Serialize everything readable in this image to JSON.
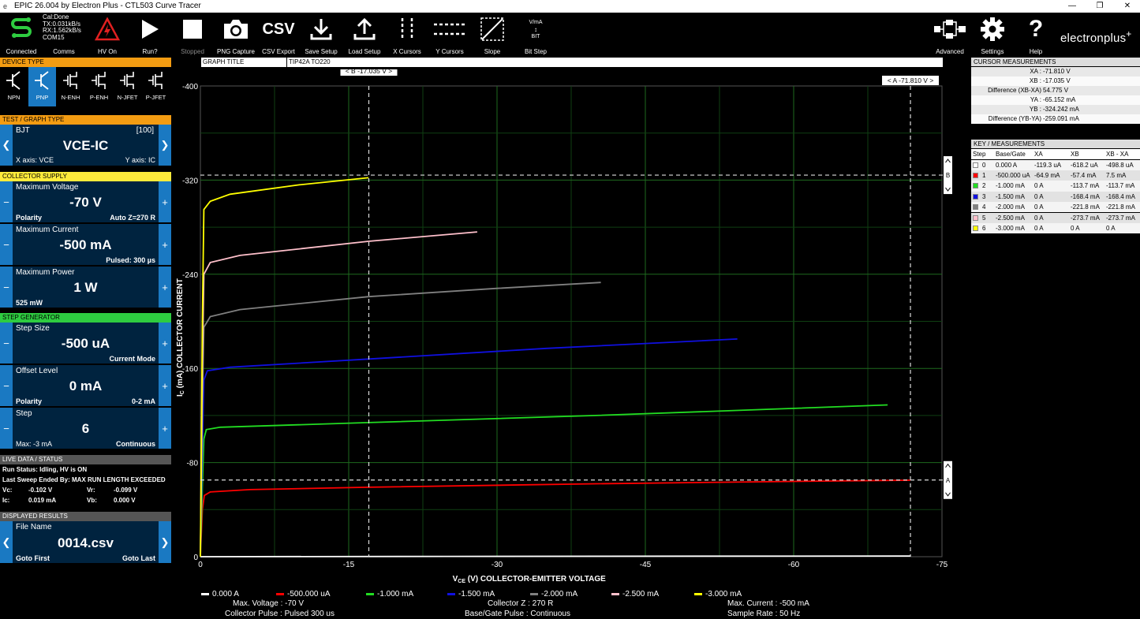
{
  "window": {
    "title": "EPIC 26.004 by Electron Plus - CTL503 Curve Tracer",
    "app_glyph": "e"
  },
  "status": {
    "line1": "Cal:Done",
    "line2": "TX:0.031kB/s",
    "line3": "RX:1.562kB/s",
    "line4": "COM15"
  },
  "toolbar": {
    "connected": "Connected",
    "comms": "Comms",
    "hv": "HV On",
    "run": "Run?",
    "stopped": "Stopped",
    "png": "PNG Capture",
    "csv": "CSV Export",
    "csv_glyph": "CSV",
    "save": "Save Setup",
    "load": "Load Setup",
    "xcursors": "X Cursors",
    "ycursors": "Y Cursors",
    "slope": "Slope",
    "bitstep": "Bit Step",
    "bit_top": "V/mA",
    "bit_bottom": "BIT",
    "advanced": "Advanced",
    "settings": "Settings",
    "help": "Help",
    "brand": "electronplus"
  },
  "device_type": {
    "header": "DEVICE TYPE",
    "items": [
      "NPN",
      "PNP",
      "N-ENH",
      "P-ENH",
      "N-JFET",
      "P-JFET"
    ],
    "selected": 1
  },
  "test": {
    "header": "TEST / GRAPH TYPE",
    "type": "BJT",
    "code": "[100]",
    "value": "VCE-IC",
    "xaxis": "X axis: VCE",
    "yaxis": "Y axis: IC"
  },
  "collector": {
    "header": "COLLECTOR SUPPLY",
    "voltage": {
      "label": "Maximum Voltage",
      "value": "-70 V",
      "sub_left": "Polarity",
      "sub_right": "Auto Z=270 R"
    },
    "current": {
      "label": "Maximum Current",
      "value": "-500 mA",
      "sub_right": "Pulsed: 300 µs"
    },
    "power": {
      "label": "Maximum Power",
      "value": "1 W",
      "sub_left": "525 mW"
    }
  },
  "step": {
    "header": "STEP GENERATOR",
    "size": {
      "label": "Step Size",
      "value": "-500 uA",
      "sub_right": "Current Mode"
    },
    "offset": {
      "label": "Offset Level",
      "value": "0 mA",
      "sub_left": "Polarity",
      "sub_right": "0-2 mA"
    },
    "step": {
      "label": "Step",
      "value": "6",
      "sub_left": "Max: -3 mA",
      "sub_right": "Continuous"
    }
  },
  "live": {
    "header": "LIVE DATA / STATUS",
    "run_status": "Run Status: Idling, HV is ON",
    "last_sweep": "Last Sweep Ended By: MAX RUN LENGTH EXCEEDED",
    "vc_label": "Vc:",
    "vc": "-0.102 V",
    "vr_label": "Vr:",
    "vr": "-0.099 V",
    "ic_label": "Ic:",
    "ic": "0.019 mA",
    "vb_label": "Vb:",
    "vb": "0.000 V"
  },
  "results": {
    "header": "DISPLAYED RESULTS",
    "label": "File Name",
    "value": "0014.csv",
    "first": "Goto First",
    "last": "Goto Last"
  },
  "graph": {
    "title_label": "GRAPH TITLE",
    "title_value": "TIP42A TO220",
    "cursor_b": "< B -17.035 V >",
    "cursor_a": "< A -71.810 V >",
    "ycursor_b": "B",
    "ycursor_a": "A"
  },
  "cursor_meas": {
    "header": "CURSOR MEASUREMENTS",
    "rows": [
      {
        "k": "XA :",
        "v": "-71.810 V"
      },
      {
        "k": "XB :",
        "v": "-17.035 V"
      },
      {
        "k": "Difference (XB-XA)",
        "v": "54.775 V"
      },
      {
        "k": "YA :",
        "v": "-65.152 mA"
      },
      {
        "k": "YB :",
        "v": "-324.242 mA"
      },
      {
        "k": "Difference (YB-YA)",
        "v": "-259.091 mA"
      }
    ]
  },
  "key_meas": {
    "header": "KEY / MEASUREMENTS",
    "columns": [
      "Step",
      "Base/Gate",
      "XA",
      "XB",
      "XB - XA"
    ],
    "rows": [
      {
        "step": "0",
        "base": "0.000 A",
        "xa": "-119.3 uA",
        "xb": "-618.2 uA",
        "diff": "-498.8 uA",
        "color": "#ffffff"
      },
      {
        "step": "1",
        "base": "-500.000 uA",
        "xa": "-64.9 mA",
        "xb": "-57.4 mA",
        "diff": "7.5 mA",
        "color": "#ff0000"
      },
      {
        "step": "2",
        "base": "-1.000 mA",
        "xa": "0 A",
        "xb": "-113.7 mA",
        "diff": "-113.7 mA",
        "color": "#22dd22"
      },
      {
        "step": "3",
        "base": "-1.500 mA",
        "xa": "0 A",
        "xb": "-168.4 mA",
        "diff": "-168.4 mA",
        "color": "#1010e0"
      },
      {
        "step": "4",
        "base": "-2.000 mA",
        "xa": "0 A",
        "xb": "-221.8 mA",
        "diff": "-221.8 mA",
        "color": "#808080"
      },
      {
        "step": "5",
        "base": "-2.500 mA",
        "xa": "0 A",
        "xb": "-273.7 mA",
        "diff": "-273.7 mA",
        "color": "#ffc0cb"
      },
      {
        "step": "6",
        "base": "-3.000 mA",
        "xa": "0 A",
        "xb": "0 A",
        "diff": "0 A",
        "color": "#ffff00"
      }
    ]
  },
  "chart_data": {
    "type": "line",
    "ylabel": "I",
    "ylabel_sub": "C",
    "ylabel_rest": " (mA) COLLECTOR CURRENT",
    "xlabel": "V",
    "xlabel_sub": "CE",
    "xlabel_rest": " (V) COLLECTOR-EMITTER VOLTAGE",
    "xlim": [
      0,
      -75
    ],
    "ylim": [
      0,
      -400
    ],
    "xticks": [
      0,
      -15,
      -30,
      -45,
      -60,
      -75
    ],
    "xtick_labels": [
      "0",
      "-15",
      "-30",
      "-45",
      "-60",
      "-75"
    ],
    "yticks": [
      0,
      -80,
      -160,
      -240,
      -320,
      -400
    ],
    "ytick_labels": [
      "0",
      "-80",
      "-160",
      "-240",
      "-320",
      "-400"
    ],
    "grid": true,
    "cursor_x": [
      -17.035,
      -71.81
    ],
    "cursor_y": [
      -324.242,
      -65.152
    ],
    "series": [
      {
        "name": "0.000 A",
        "color": "#ffffff",
        "points": [
          [
            0,
            0
          ],
          [
            -25,
            -0.3
          ],
          [
            -71.8,
            -0.6
          ]
        ]
      },
      {
        "name": "-500.000 uA",
        "color": "#ff0000",
        "points": [
          [
            0,
            0
          ],
          [
            -0.2,
            -40
          ],
          [
            -0.4,
            -52
          ],
          [
            -1,
            -55
          ],
          [
            -5,
            -57
          ],
          [
            -17,
            -59
          ],
          [
            -40,
            -62
          ],
          [
            -60,
            -64
          ],
          [
            -71.8,
            -65
          ]
        ]
      },
      {
        "name": "-1.000 mA",
        "color": "#22dd22",
        "points": [
          [
            0,
            0
          ],
          [
            -0.2,
            -60
          ],
          [
            -0.35,
            -100
          ],
          [
            -0.6,
            -108
          ],
          [
            -2,
            -110
          ],
          [
            -17,
            -114
          ],
          [
            -40,
            -120
          ],
          [
            -60,
            -126
          ],
          [
            -69.5,
            -129
          ]
        ]
      },
      {
        "name": "-1.500 mA",
        "color": "#1010e0",
        "points": [
          [
            0,
            0
          ],
          [
            -0.2,
            -90
          ],
          [
            -0.35,
            -150
          ],
          [
            -0.7,
            -158
          ],
          [
            -3,
            -161
          ],
          [
            -17,
            -168
          ],
          [
            -35,
            -177
          ],
          [
            -54.3,
            -185
          ]
        ]
      },
      {
        "name": "-2.000 mA",
        "color": "#808080",
        "points": [
          [
            0,
            0
          ],
          [
            -0.2,
            -130
          ],
          [
            -0.35,
            -195
          ],
          [
            -1,
            -204
          ],
          [
            -4,
            -210
          ],
          [
            -17,
            -221
          ],
          [
            -30,
            -228
          ],
          [
            -40.5,
            -233
          ]
        ]
      },
      {
        "name": "-2.500 mA",
        "color": "#ffc0cb",
        "points": [
          [
            0,
            0
          ],
          [
            -0.2,
            -160
          ],
          [
            -0.35,
            -240
          ],
          [
            -1,
            -250
          ],
          [
            -4,
            -256
          ],
          [
            -17,
            -268
          ],
          [
            -28,
            -276
          ]
        ]
      },
      {
        "name": "-3.000 mA",
        "color": "#ffff00",
        "points": [
          [
            0,
            0
          ],
          [
            -0.2,
            -200
          ],
          [
            -0.35,
            -295
          ],
          [
            -1,
            -302
          ],
          [
            -3,
            -308
          ],
          [
            -10,
            -316
          ],
          [
            -17,
            -322
          ]
        ]
      }
    ]
  },
  "footer": {
    "max_voltage": "Max. Voltage : -70 V",
    "collector_pulse": "Collector Pulse : Pulsed 300 us",
    "collector_z": "Collector Z : 270 R",
    "base_pulse": "Base/Gate Pulse  : Continuous",
    "max_current": "Max. Current : -500 mA",
    "sample_rate": "Sample Rate : 50 Hz"
  }
}
